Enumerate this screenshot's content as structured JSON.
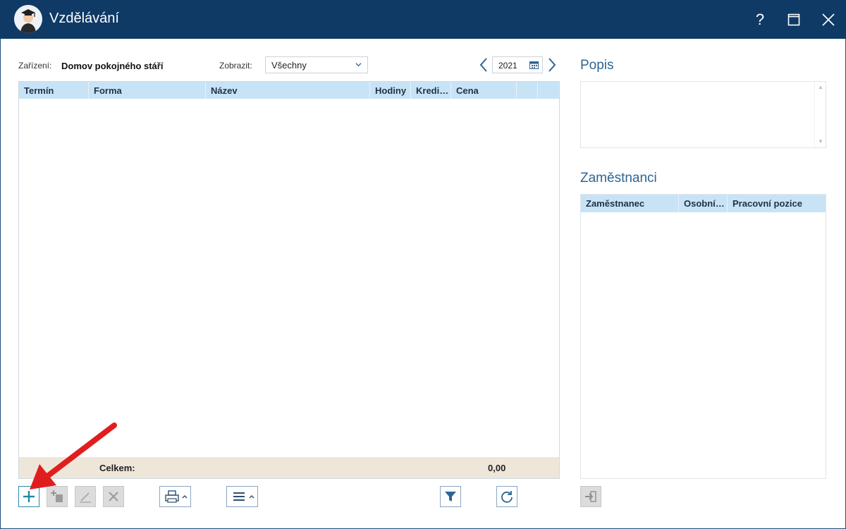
{
  "window": {
    "title": "Vzdělávání",
    "help": "?"
  },
  "filters": {
    "facility_label": "Zařízení:",
    "facility_value": "Domov pokojného stáří",
    "show_label": "Zobrazit:",
    "show_value": "Všechny",
    "year": "2021"
  },
  "main_grid": {
    "columns": [
      "Termín",
      "Forma",
      "Název",
      "Hodiny",
      "Kredi…",
      "Cena"
    ],
    "rows": [],
    "total_label": "Celkem:",
    "total_value": "0,00"
  },
  "right_panel": {
    "description_title": "Popis",
    "description_text": "",
    "employees_title": "Zaměstnanci",
    "employee_columns": [
      "Zaměstnanec",
      "Osobní…",
      "Pracovní pozice"
    ]
  },
  "toolbar": {
    "add_icon": "plus-icon",
    "copy_icon": "copy-add-icon",
    "edit_icon": "pencil-icon",
    "delete_icon": "x-icon",
    "print_icon": "printer-icon",
    "menu_icon": "hamburger-icon",
    "filter_icon": "funnel-icon",
    "refresh_icon": "refresh-icon",
    "export_icon": "transfer-icon"
  },
  "colors": {
    "titlebar": "#0f3a66",
    "grid_header": "#c8e3f6",
    "grid_footer": "#efe6da",
    "accent_teal": "#1d8aa3",
    "annotation_arrow": "#e01e1e"
  }
}
